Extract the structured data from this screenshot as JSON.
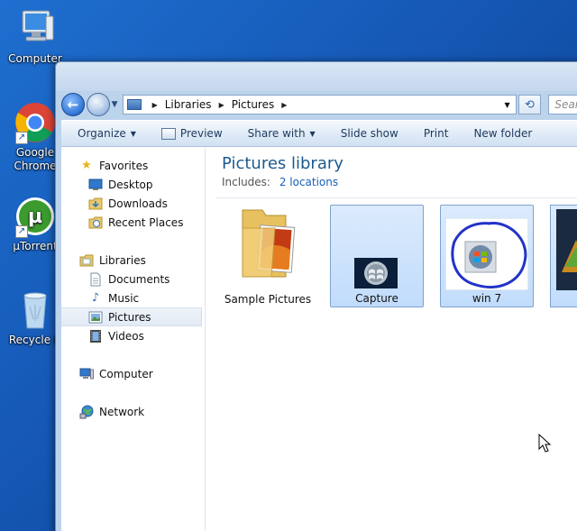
{
  "desktop": {
    "icons": [
      {
        "label": "Computer"
      },
      {
        "label": "Google\nChrome"
      },
      {
        "label": "µTorrent"
      },
      {
        "label": "Recycle B"
      }
    ]
  },
  "window": {
    "breadcrumb": [
      "Libraries",
      "Pictures"
    ],
    "search_placeholder": "Sear",
    "toolbar": {
      "organize": "Organize",
      "preview": "Preview",
      "share_with": "Share with",
      "slide_show": "Slide show",
      "print": "Print",
      "new_folder": "New folder"
    },
    "nav": {
      "favorites": "Favorites",
      "desktop": "Desktop",
      "downloads": "Downloads",
      "recent_places": "Recent Places",
      "libraries": "Libraries",
      "documents": "Documents",
      "music": "Music",
      "pictures": "Pictures",
      "videos": "Videos",
      "computer": "Computer",
      "network": "Network"
    },
    "library": {
      "title": "Pictures library",
      "includes_label": "Includes:",
      "locations_link": "2 locations"
    },
    "items": [
      {
        "name": "Sample Pictures"
      },
      {
        "name": "Capture"
      },
      {
        "name": "win 7"
      }
    ]
  },
  "colors": {
    "desktop_bg": "#1659b6",
    "selection": "#c1dcfc",
    "library_title": "#1e5a8e",
    "link": "#1a5fb4"
  }
}
